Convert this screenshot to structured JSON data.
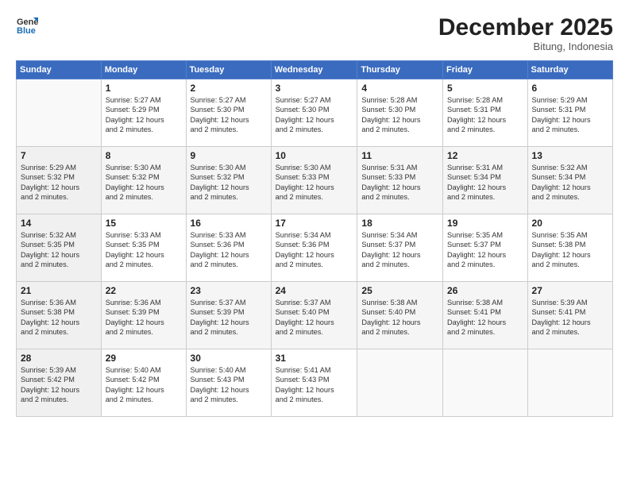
{
  "header": {
    "logo": {
      "general": "General",
      "blue": "Blue"
    },
    "title": "December 2025",
    "location": "Bitung, Indonesia"
  },
  "weekdays": [
    "Sunday",
    "Monday",
    "Tuesday",
    "Wednesday",
    "Thursday",
    "Friday",
    "Saturday"
  ],
  "weeks": [
    [
      {
        "day": "",
        "info": ""
      },
      {
        "day": "1",
        "info": "Sunrise: 5:27 AM\nSunset: 5:29 PM\nDaylight: 12 hours\nand 2 minutes."
      },
      {
        "day": "2",
        "info": "Sunrise: 5:27 AM\nSunset: 5:30 PM\nDaylight: 12 hours\nand 2 minutes."
      },
      {
        "day": "3",
        "info": "Sunrise: 5:27 AM\nSunset: 5:30 PM\nDaylight: 12 hours\nand 2 minutes."
      },
      {
        "day": "4",
        "info": "Sunrise: 5:28 AM\nSunset: 5:30 PM\nDaylight: 12 hours\nand 2 minutes."
      },
      {
        "day": "5",
        "info": "Sunrise: 5:28 AM\nSunset: 5:31 PM\nDaylight: 12 hours\nand 2 minutes."
      },
      {
        "day": "6",
        "info": "Sunrise: 5:29 AM\nSunset: 5:31 PM\nDaylight: 12 hours\nand 2 minutes."
      }
    ],
    [
      {
        "day": "7",
        "info": "Sunrise: 5:29 AM\nSunset: 5:32 PM\nDaylight: 12 hours\nand 2 minutes."
      },
      {
        "day": "8",
        "info": "Sunrise: 5:30 AM\nSunset: 5:32 PM\nDaylight: 12 hours\nand 2 minutes."
      },
      {
        "day": "9",
        "info": "Sunrise: 5:30 AM\nSunset: 5:32 PM\nDaylight: 12 hours\nand 2 minutes."
      },
      {
        "day": "10",
        "info": "Sunrise: 5:30 AM\nSunset: 5:33 PM\nDaylight: 12 hours\nand 2 minutes."
      },
      {
        "day": "11",
        "info": "Sunrise: 5:31 AM\nSunset: 5:33 PM\nDaylight: 12 hours\nand 2 minutes."
      },
      {
        "day": "12",
        "info": "Sunrise: 5:31 AM\nSunset: 5:34 PM\nDaylight: 12 hours\nand 2 minutes."
      },
      {
        "day": "13",
        "info": "Sunrise: 5:32 AM\nSunset: 5:34 PM\nDaylight: 12 hours\nand 2 minutes."
      }
    ],
    [
      {
        "day": "14",
        "info": "Sunrise: 5:32 AM\nSunset: 5:35 PM\nDaylight: 12 hours\nand 2 minutes."
      },
      {
        "day": "15",
        "info": "Sunrise: 5:33 AM\nSunset: 5:35 PM\nDaylight: 12 hours\nand 2 minutes."
      },
      {
        "day": "16",
        "info": "Sunrise: 5:33 AM\nSunset: 5:36 PM\nDaylight: 12 hours\nand 2 minutes."
      },
      {
        "day": "17",
        "info": "Sunrise: 5:34 AM\nSunset: 5:36 PM\nDaylight: 12 hours\nand 2 minutes."
      },
      {
        "day": "18",
        "info": "Sunrise: 5:34 AM\nSunset: 5:37 PM\nDaylight: 12 hours\nand 2 minutes."
      },
      {
        "day": "19",
        "info": "Sunrise: 5:35 AM\nSunset: 5:37 PM\nDaylight: 12 hours\nand 2 minutes."
      },
      {
        "day": "20",
        "info": "Sunrise: 5:35 AM\nSunset: 5:38 PM\nDaylight: 12 hours\nand 2 minutes."
      }
    ],
    [
      {
        "day": "21",
        "info": "Sunrise: 5:36 AM\nSunset: 5:38 PM\nDaylight: 12 hours\nand 2 minutes."
      },
      {
        "day": "22",
        "info": "Sunrise: 5:36 AM\nSunset: 5:39 PM\nDaylight: 12 hours\nand 2 minutes."
      },
      {
        "day": "23",
        "info": "Sunrise: 5:37 AM\nSunset: 5:39 PM\nDaylight: 12 hours\nand 2 minutes."
      },
      {
        "day": "24",
        "info": "Sunrise: 5:37 AM\nSunset: 5:40 PM\nDaylight: 12 hours\nand 2 minutes."
      },
      {
        "day": "25",
        "info": "Sunrise: 5:38 AM\nSunset: 5:40 PM\nDaylight: 12 hours\nand 2 minutes."
      },
      {
        "day": "26",
        "info": "Sunrise: 5:38 AM\nSunset: 5:41 PM\nDaylight: 12 hours\nand 2 minutes."
      },
      {
        "day": "27",
        "info": "Sunrise: 5:39 AM\nSunset: 5:41 PM\nDaylight: 12 hours\nand 2 minutes."
      }
    ],
    [
      {
        "day": "28",
        "info": "Sunrise: 5:39 AM\nSunset: 5:42 PM\nDaylight: 12 hours\nand 2 minutes."
      },
      {
        "day": "29",
        "info": "Sunrise: 5:40 AM\nSunset: 5:42 PM\nDaylight: 12 hours\nand 2 minutes."
      },
      {
        "day": "30",
        "info": "Sunrise: 5:40 AM\nSunset: 5:43 PM\nDaylight: 12 hours\nand 2 minutes."
      },
      {
        "day": "31",
        "info": "Sunrise: 5:41 AM\nSunset: 5:43 PM\nDaylight: 12 hours\nand 2 minutes."
      },
      {
        "day": "",
        "info": ""
      },
      {
        "day": "",
        "info": ""
      },
      {
        "day": "",
        "info": ""
      }
    ]
  ]
}
